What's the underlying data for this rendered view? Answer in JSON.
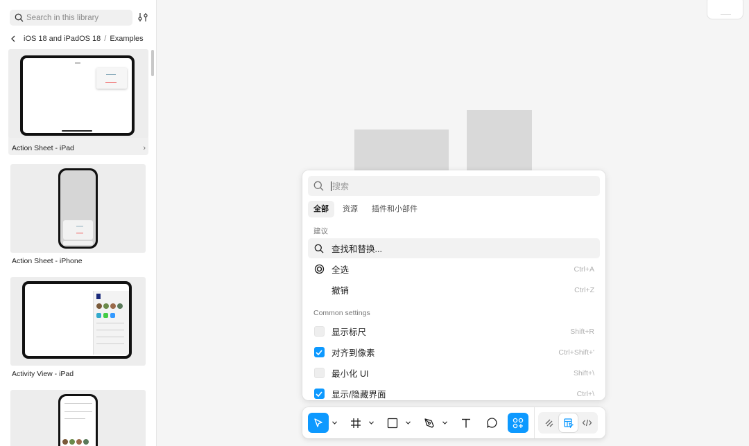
{
  "sidebar": {
    "search_placeholder": "Search in this library",
    "breadcrumb": {
      "parent": "iOS 18 and iPadOS 18",
      "separator": "/",
      "current": "Examples"
    },
    "cards": [
      {
        "label": "Action Sheet - iPad"
      },
      {
        "label": "Action Sheet - iPhone"
      },
      {
        "label": "Activity View - iPad"
      },
      {
        "label": ""
      }
    ]
  },
  "palette": {
    "search_placeholder": "搜索",
    "tabs": [
      "全部",
      "资源",
      "插件和小部件"
    ],
    "sections": {
      "suggestions": "建议",
      "common": "Common settings"
    },
    "suggestions": [
      {
        "label": "查找和替换...",
        "shortcut": "",
        "icon": "search-icon"
      },
      {
        "label": "全选",
        "shortcut": "Ctrl+A",
        "icon": "target-icon"
      },
      {
        "label": "撤销",
        "shortcut": "Ctrl+Z",
        "icon": ""
      }
    ],
    "settings": [
      {
        "label": "显示标尺",
        "shortcut": "Shift+R",
        "checked": false
      },
      {
        "label": "对齐到像素",
        "shortcut": "Ctrl+Shift+'",
        "checked": true
      },
      {
        "label": "最小化 UI",
        "shortcut": "Shift+\\",
        "checked": false
      },
      {
        "label": "显示/隐藏界面",
        "shortcut": "Ctrl+\\",
        "checked": true
      }
    ]
  },
  "toolbar": {
    "tools": [
      "move-tool",
      "frame-tool",
      "shape-tool",
      "pen-tool",
      "text-tool",
      "comment-tool",
      "actions-tool"
    ],
    "selected_tool": "move-tool",
    "modes": [
      "draw-mode",
      "design-mode",
      "dev-mode"
    ],
    "selected_mode": "design-mode"
  },
  "colors": {
    "accent": "#0d99ff",
    "canvas": "#f5f5f5",
    "placeholder_block": "#d9d9d9"
  }
}
